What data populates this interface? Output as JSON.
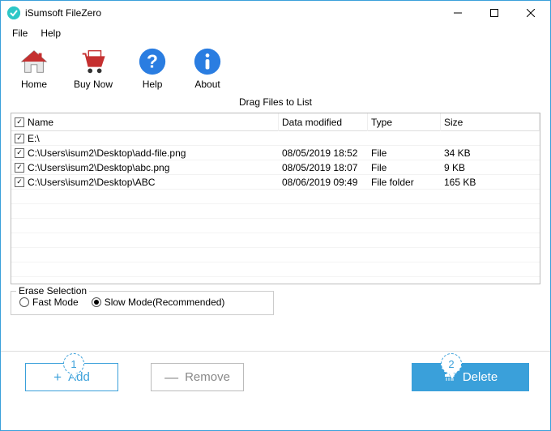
{
  "titlebar": {
    "title": "iSumsoft FileZero"
  },
  "menubar": {
    "file": "File",
    "help": "Help"
  },
  "toolbar": {
    "home": "Home",
    "buy": "Buy Now",
    "help": "Help",
    "about": "About"
  },
  "content": {
    "drag_label": "Drag Files to List",
    "columns": {
      "name": "Name",
      "date": "Data modified",
      "type": "Type",
      "size": "Size"
    },
    "rows": [
      {
        "name": "E:\\",
        "date": "",
        "type": "",
        "size": ""
      },
      {
        "name": "C:\\Users\\isum2\\Desktop\\add-file.png",
        "date": "08/05/2019 18:52",
        "type": "File",
        "size": "34 KB"
      },
      {
        "name": "C:\\Users\\isum2\\Desktop\\abc.png",
        "date": "08/05/2019 18:07",
        "type": "File",
        "size": "9 KB"
      },
      {
        "name": "C:\\Users\\isum2\\Desktop\\ABC",
        "date": "08/06/2019 09:49",
        "type": "File folder",
        "size": "165 KB"
      }
    ]
  },
  "erase": {
    "legend": "Erase Selection",
    "fast": "Fast Mode",
    "slow": "Slow Mode(Recommended)"
  },
  "buttons": {
    "add": "Add",
    "remove": "Remove",
    "delete": "Delete"
  },
  "callouts": {
    "one": "1",
    "two": "2"
  }
}
